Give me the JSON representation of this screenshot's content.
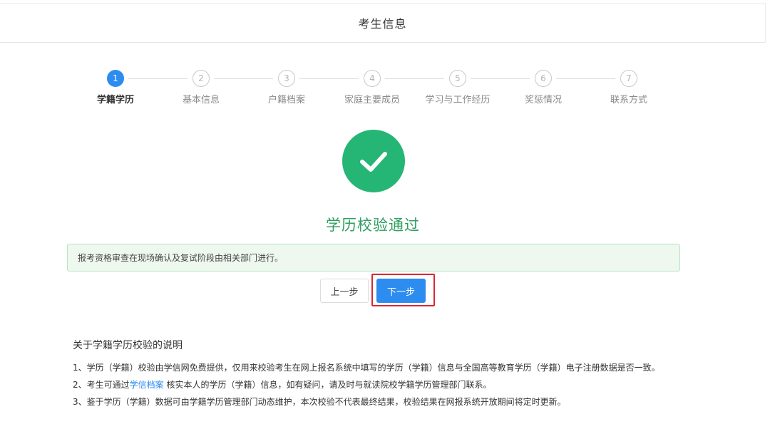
{
  "header": {
    "title": "考生信息"
  },
  "steps": [
    {
      "number": "1",
      "label": "学籍学历",
      "active": true
    },
    {
      "number": "2",
      "label": "基本信息",
      "active": false
    },
    {
      "number": "3",
      "label": "户籍档案",
      "active": false
    },
    {
      "number": "4",
      "label": "家庭主要成员",
      "active": false
    },
    {
      "number": "5",
      "label": "学习与工作经历",
      "active": false
    },
    {
      "number": "6",
      "label": "奖惩情况",
      "active": false
    },
    {
      "number": "7",
      "label": "联系方式",
      "active": false
    }
  ],
  "result": {
    "icon": "check-circle-icon",
    "title": "学历校验通过",
    "notice": "报考资格审查在现场确认及复试阶段由相关部门进行。"
  },
  "buttons": {
    "prev": "上一步",
    "next": "下一步"
  },
  "explanation": {
    "title": "关于学籍学历校验的说明",
    "item1": "1、学历（学籍）校验由学信网免费提供，仅用来校验考生在网上报名系统中填写的学历（学籍）信息与全国高等教育学历（学籍）电子注册数据是否一致。",
    "item2_prefix": "2、考生可通过",
    "item2_link": "学信档案",
    "item2_suffix": " 核实本人的学历（学籍）信息，如有疑问，请及时与就读院校学籍学历管理部门联系。",
    "item3": "3、鉴于学历（学籍）数据可由学籍学历管理部门动态维护，本次校验不代表最终结果，校验结果在网报系统开放期间将定时更新。"
  },
  "colors": {
    "accent": "#2d8cf0",
    "success": "#25b574",
    "highlight": "#d9282f"
  }
}
